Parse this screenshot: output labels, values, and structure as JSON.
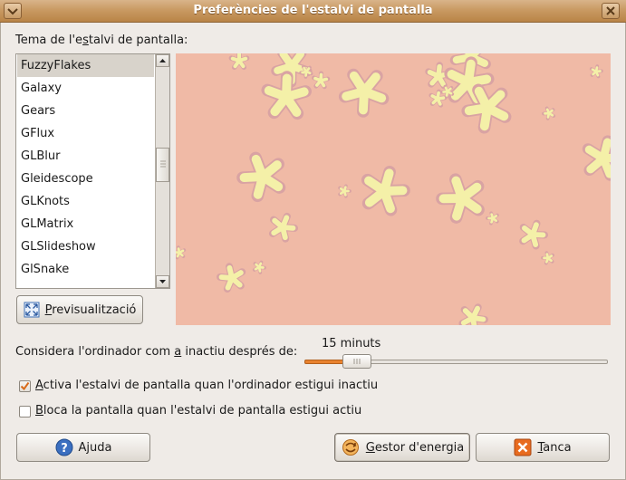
{
  "window": {
    "title": "Preferències de l'estalvi de pantalla"
  },
  "theme_label": "Tema de l'estalvi de pantalla:",
  "themes": [
    "FuzzyFlakes",
    "Galaxy",
    "Gears",
    "GFlux",
    "GLBlur",
    "Gleidescope",
    "GLKnots",
    "GLMatrix",
    "GLSlideshow",
    "GlSnake"
  ],
  "selected_theme": "FuzzyFlakes",
  "preview_button": {
    "label": "Previsualització"
  },
  "idle": {
    "label": "Considera l'ordinador com a inactiu després de:",
    "value_text": "15 minuts",
    "fraction": 0.14
  },
  "options": {
    "activate": {
      "label": "Activa l'estalvi de pantalla quan l'ordinador estigui inactiu",
      "checked": true
    },
    "lock": {
      "label": "Bloca la pantalla quan l'estalvi de pantalla estigui actiu",
      "checked": false
    }
  },
  "buttons": {
    "help": "Ajuda",
    "power": "Gestor d'energia",
    "close": "Tanca"
  },
  "colors": {
    "preview_bg": "#f0baa6",
    "flake": "#f4f0a8",
    "flake_outline": "#d9a3a3",
    "title_bar": "#c99a63",
    "slider_fill": "#e8822e"
  }
}
